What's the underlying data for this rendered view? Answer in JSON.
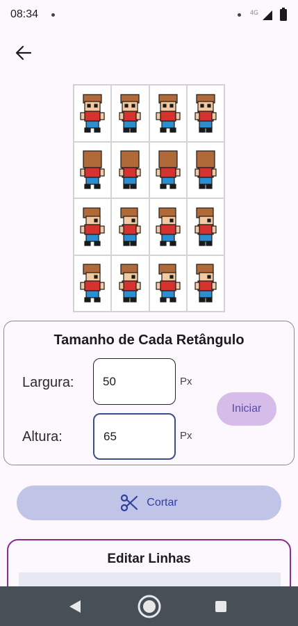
{
  "status": {
    "time": "08:34",
    "network": "4G"
  },
  "card": {
    "title": "Tamanho de Cada Retângulo",
    "width_label": "Largura:",
    "width_value": "50",
    "height_label": "Altura:",
    "height_value": "65",
    "unit": "Px",
    "start_button": "Iniciar"
  },
  "cut_button": "Cortar",
  "edit_card": {
    "title": "Editar Linhas"
  },
  "sprite_sheet": {
    "rows": 4,
    "cols": 4,
    "rows_facing": [
      "down",
      "up",
      "side",
      "side"
    ]
  },
  "icons": [
    "back-arrow-icon",
    "scissors-icon",
    "nav-back-icon",
    "nav-home-icon",
    "nav-recents-icon"
  ],
  "colors": {
    "accent": "#2f3f9e",
    "start_bg": "#d6bce8",
    "cut_bg": "#c0c5e8",
    "edit_border": "#8a2a8e"
  }
}
